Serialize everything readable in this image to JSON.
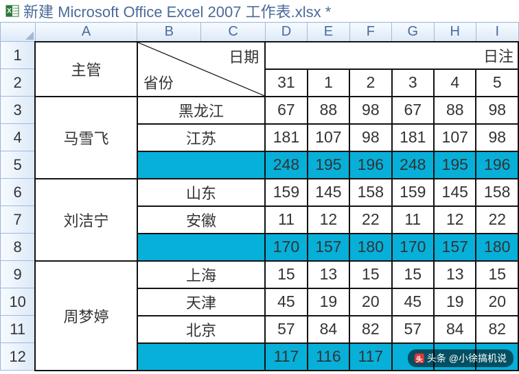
{
  "window": {
    "title": "新建 Microsoft Office Excel 2007 工作表.xlsx *"
  },
  "columns": [
    "A",
    "B",
    "C",
    "D",
    "E",
    "F",
    "G",
    "H",
    "I"
  ],
  "rows": [
    "1",
    "2",
    "3",
    "4",
    "5",
    "6",
    "7",
    "8",
    "9",
    "10",
    "11",
    "12"
  ],
  "header": {
    "supervisor_label": "主管",
    "date_label": "日期",
    "province_label": "省份",
    "right_label": "日注",
    "day_numbers": [
      "31",
      "1",
      "2",
      "3",
      "4",
      "5"
    ]
  },
  "groups": [
    {
      "name": "马雪飞",
      "rows": [
        {
          "province": "黑龙江",
          "values": [
            "67",
            "88",
            "98",
            "67",
            "88",
            "98"
          ]
        },
        {
          "province": "江苏",
          "values": [
            "181",
            "107",
            "98",
            "181",
            "107",
            "98"
          ]
        }
      ],
      "total": [
        "248",
        "195",
        "196",
        "248",
        "195",
        "196"
      ]
    },
    {
      "name": "刘洁宁",
      "rows": [
        {
          "province": "山东",
          "values": [
            "159",
            "145",
            "158",
            "159",
            "145",
            "158"
          ]
        },
        {
          "province": "安徽",
          "values": [
            "11",
            "12",
            "22",
            "11",
            "12",
            "22"
          ]
        }
      ],
      "total": [
        "170",
        "157",
        "180",
        "170",
        "157",
        "180"
      ]
    },
    {
      "name": "周梦婷",
      "rows": [
        {
          "province": "上海",
          "values": [
            "15",
            "13",
            "15",
            "15",
            "13",
            "15"
          ]
        },
        {
          "province": "天津",
          "values": [
            "45",
            "19",
            "20",
            "45",
            "19",
            "20"
          ]
        },
        {
          "province": "北京",
          "values": [
            "57",
            "84",
            "82",
            "57",
            "84",
            "82"
          ]
        }
      ],
      "total": [
        "117",
        "116",
        "117",
        "",
        "",
        ""
      ]
    }
  ],
  "watermark": {
    "prefix": "头条",
    "text": "@小徐搞机说"
  }
}
